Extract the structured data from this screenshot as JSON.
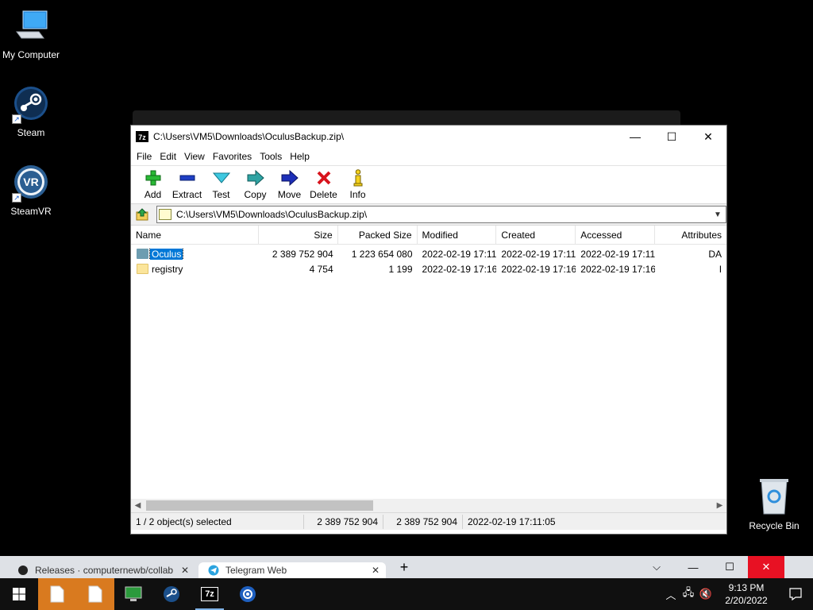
{
  "desktop": {
    "icons": [
      {
        "label": "My Computer"
      },
      {
        "label": "Steam"
      },
      {
        "label": "SteamVR"
      },
      {
        "label": "Recycle Bin"
      }
    ]
  },
  "window": {
    "title": "C:\\Users\\VM5\\Downloads\\OculusBackup.zip\\",
    "menu": [
      "File",
      "Edit",
      "View",
      "Favorites",
      "Tools",
      "Help"
    ],
    "toolbar": [
      "Add",
      "Extract",
      "Test",
      "Copy",
      "Move",
      "Delete",
      "Info"
    ],
    "address": "C:\\Users\\VM5\\Downloads\\OculusBackup.zip\\",
    "columns": [
      "Name",
      "Size",
      "Packed Size",
      "Modified",
      "Created",
      "Accessed",
      "Attributes"
    ],
    "rows": [
      {
        "name": "Oculus",
        "size": "2 389 752 904",
        "packed": "1 223 654 080",
        "modified": "2022-02-19 17:11",
        "created": "2022-02-19 17:11",
        "accessed": "2022-02-19 17:11",
        "attr": "DA",
        "selected": true
      },
      {
        "name": "registry",
        "size": "4 754",
        "packed": "1 199",
        "modified": "2022-02-19 17:16",
        "created": "2022-02-19 17:16",
        "accessed": "2022-02-19 17:16",
        "attr": "I",
        "selected": false
      }
    ],
    "status": {
      "selection": "1 / 2 object(s) selected",
      "size": "2 389 752 904",
      "packed": "2 389 752 904",
      "date": "2022-02-19 17:11:05"
    }
  },
  "browser": {
    "tabs": [
      {
        "label": "Releases · computernewb/collab"
      },
      {
        "label": "Telegram Web"
      }
    ]
  },
  "taskbar": {
    "time": "9:13 PM",
    "date": "2/20/2022"
  }
}
